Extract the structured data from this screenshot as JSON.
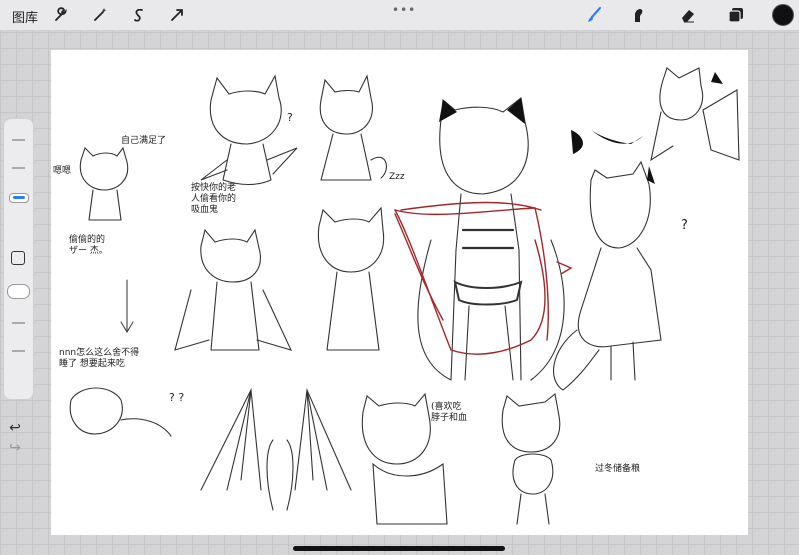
{
  "toolbar": {
    "gallery_label": "图库",
    "tools_left": [
      "wrench-icon",
      "magic-wand-icon",
      "selection-icon",
      "transform-icon"
    ],
    "tools_right": [
      "brush-icon",
      "smudge-icon",
      "eraser-icon",
      "layers-icon"
    ],
    "active_tool": "brush-icon",
    "active_tool_color": "#2f7df6",
    "current_color": "#111111"
  },
  "sidebar": {
    "size_slider_color": "#2f7df6",
    "undo_glyph": "↩",
    "redo_glyph": "↪"
  },
  "canvas": {
    "notes": [
      "自己满足了",
      "嗯嗯",
      "按快你的老\n人偷看你的\n吸血鬼",
      "偷偷的的\nザー 杰。",
      "Zzz",
      "?",
      "nnn怎么这么舍不得\n睡了 想要起来吃",
      "? ?",
      "(喜欢吃\n脖子和血",
      "过冬储备粮",
      "?"
    ]
  }
}
